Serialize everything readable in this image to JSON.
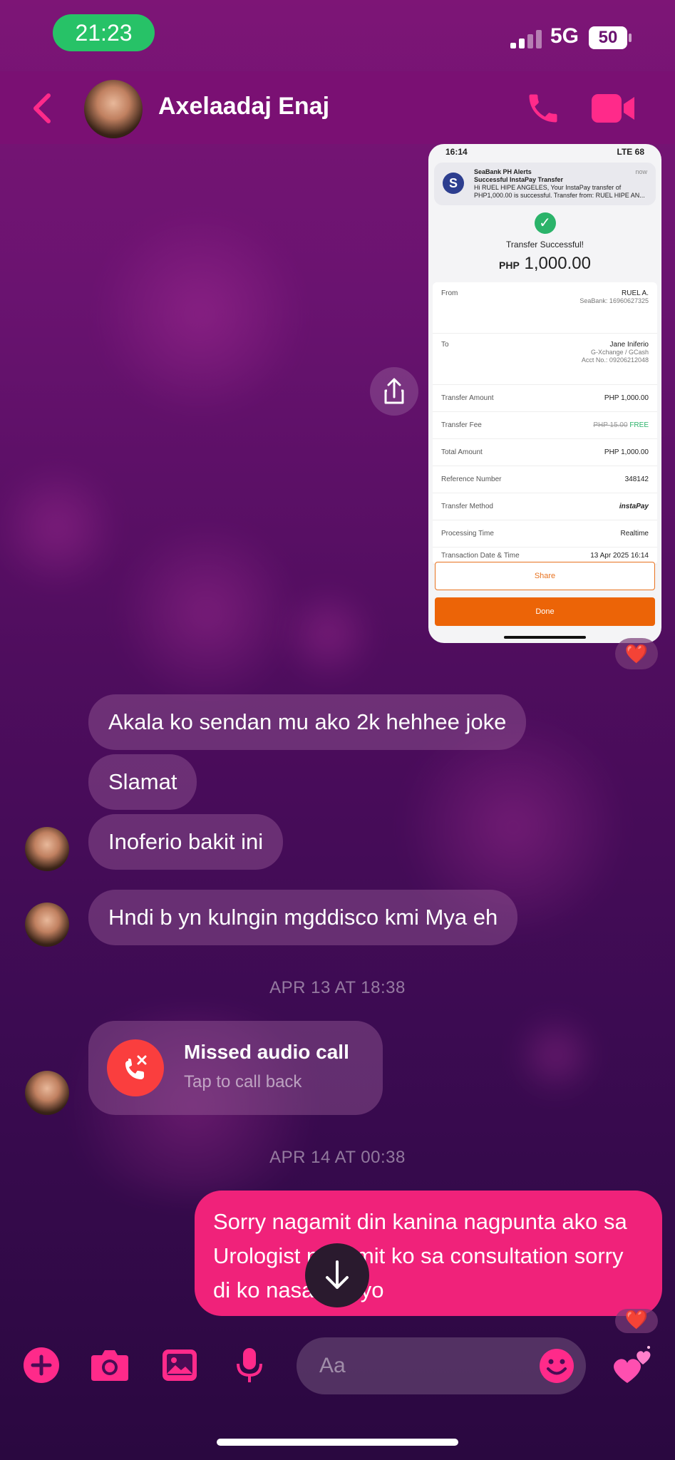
{
  "status_bar": {
    "time": "21:23",
    "network": "5G",
    "battery": "50"
  },
  "header": {
    "contact_name": "Axelaadaj Enaj"
  },
  "shared_screenshot": {
    "status_time": "16:14",
    "status_right": "LTE 68",
    "notification": {
      "app": "SeaBank PH Alerts",
      "title": "Successful InstaPay Transfer",
      "body": "Hi RUEL HIPE ANGELES, Your InstaPay transfer of PHP1,000.00 is successful. Transfer from: RUEL HIPE AN...",
      "time": "now"
    },
    "status_text": "Transfer Successful!",
    "currency": "PHP",
    "amount": "1,000.00",
    "rows": [
      {
        "label": "From",
        "value": "RUEL A.",
        "sub": "SeaBank: 16960627325"
      },
      {
        "label": "To",
        "value": "Jane Iniferio",
        "sub": "G-Xchange / GCash",
        "sub2": "Acct No.: 09206212048"
      },
      {
        "label": "Transfer Amount",
        "value": "PHP 1,000.00"
      },
      {
        "label": "Transfer Fee",
        "value_strike": "PHP 15.00",
        "value": "FREE"
      },
      {
        "label": "Total Amount",
        "value": "PHP 1,000.00"
      },
      {
        "label": "Reference Number",
        "value": "348142"
      },
      {
        "label": "Transfer Method",
        "value": "instaPay"
      },
      {
        "label": "Processing Time",
        "value": "Realtime"
      },
      {
        "label": "Transaction Date & Time",
        "value": "13 Apr 2025 16:14"
      }
    ],
    "share_label": "Share",
    "done_label": "Done"
  },
  "reactions": {
    "heart": "❤️"
  },
  "messages": [
    {
      "text": "Akala ko sendan mu ako 2k hehhee joke"
    },
    {
      "text": "Slamat"
    },
    {
      "text": "Inoferio bakit ini"
    },
    {
      "text": "Hndi b yn kulngin mgddisco kmi Mya eh"
    }
  ],
  "date_separators": [
    "APR 13 AT 18:38",
    "APR 14 AT 00:38"
  ],
  "missed_call": {
    "title": "Missed audio call",
    "subtitle": "Tap to call back"
  },
  "outgoing": {
    "text": "Sorry nagamit din kanina nagpunta ako sa Urologist nagamit ko sa consultation sorry di ko nasabi sayo"
  },
  "composer": {
    "placeholder": "Aa"
  },
  "colors": {
    "accent": "#f0227a",
    "header_bg": "#7a1073",
    "missed_icon": "#fa3e3e",
    "time_pill": "#27c267"
  },
  "icons": [
    "back-icon",
    "phone-icon",
    "video-icon",
    "share-icon",
    "plus-icon",
    "camera-icon",
    "gallery-icon",
    "mic-icon",
    "emoji-icon",
    "hearts-icon",
    "arrow-down-icon",
    "missed-call-icon"
  ]
}
